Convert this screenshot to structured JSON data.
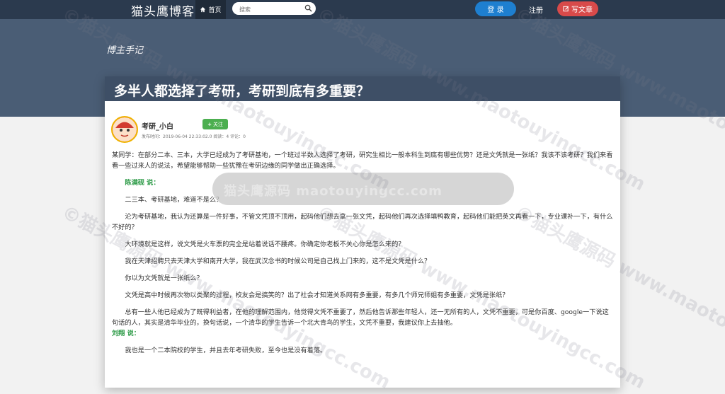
{
  "nav": {
    "brand": "猫头鹰博客",
    "home_label": "首页",
    "search_placeholder": "搜索",
    "login_label": "登 录",
    "register_label": "注册",
    "write_label": "写文章"
  },
  "banner": {
    "title": "博主手记"
  },
  "article": {
    "title": "多半人都选择了考研，考研到底有多重要？",
    "author": "考研_小白",
    "follow_label": "关注",
    "meta": "发布时间：2019-06-04 22:33:02.0    阅读：4    评论：0",
    "paragraphs": [
      "某同学：在部分二本、三本，大学已经成为了考研基地，一个班过半数人选择了考研，研究生相比一般本科生到底有哪些优势？还是文凭就是一张纸？我该不该考研？我们来看看一些过来人的说法，希望能够帮助一些犹豫在考研边缘的同学做出正确选择。",
      "陈满砚 说：",
      "二三本、考研基地，难道不是么？",
      "沦为考研基地，我认为还算是一件好事，不管文凭顶不顶用，起码他们想去拿一张文凭，起码他们再次选择填鸭教育，起码他们能把英文再看一下，专业课补一下，有什么不好的？",
      "大环境就是这样，说文凭是火车票的完全是站着说话不腰疼。你确定你老板不关心你是怎么来的？",
      "我在天津招聘只去天津大学和南开大学，我在武汉念书的时候公司是自己找上门来的，这不是文凭是什么？",
      "你以为文凭就是一张纸么？",
      "文凭是高中时候再次物以类聚的过程，校友会是搞笑的？出了社会才知道关系网有多重要，有多几个师兄师姐有多重要，文凭是张纸？",
      "总有一些人他已经成为了既得利益者，在他的理解范围内，他觉得文凭不重要了，然后他告诉那些年轻人，还一无所有的人，文凭不重要，可是你百度、google一下说这句话的人，其实是清华毕业的，换句话说，一个清华的学生告诉一个北大青鸟的学生，文凭不重要，我建议你上去抽他。",
      "刘翔 说：",
      "我也是一个二本院校的学生，并且去年考研失败，至今也是没有着落。"
    ]
  },
  "overlay": {
    "text": "猫头鹰源码 maotouyingcc.com"
  },
  "watermark": {
    "text": "©猫头鹰源码 www.maotouyingcc.com"
  },
  "colors": {
    "nav_bg": "#2b3a4e",
    "banner_bg": "#4a5d75",
    "login": "#1e7fd0",
    "write": "#d84a4a",
    "follow": "#4caf50",
    "speaker": "#2e9b48"
  }
}
